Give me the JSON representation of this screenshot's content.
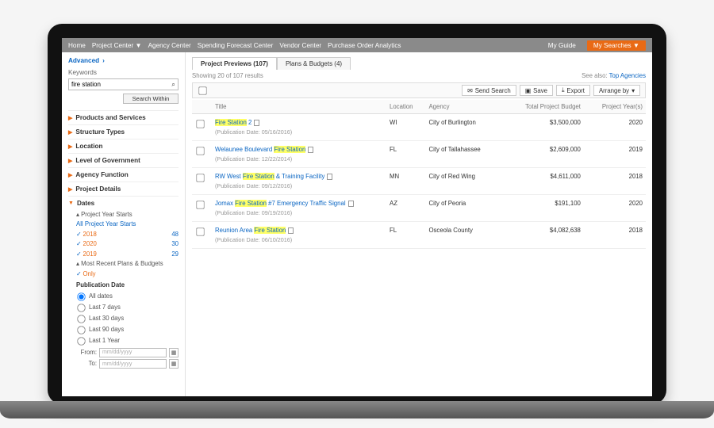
{
  "nav": {
    "items": [
      "Home",
      "Project Center ▼",
      "Agency Center",
      "Spending Forecast Center",
      "Vendor Center",
      "Purchase Order Analytics"
    ],
    "myguide": "My Guide",
    "mysearches": "My Searches ▼"
  },
  "sidebar": {
    "advanced": "Advanced",
    "keywords_label": "Keywords",
    "keywords_value": "fire station",
    "search_within": "Search Within",
    "facets": [
      "Products and Services",
      "Structure Types",
      "Location",
      "Level of Government",
      "Agency Function",
      "Project Details",
      "Dates"
    ],
    "dates": {
      "pys_label": "Project Year Starts",
      "all_pys": "All Project Year Starts",
      "years": [
        {
          "y": "2018",
          "n": "48"
        },
        {
          "y": "2020",
          "n": "30"
        },
        {
          "y": "2019",
          "n": "29"
        }
      ],
      "mrpb": "Most Recent Plans & Budgets",
      "only": "Only",
      "pubdate_label": "Publication Date",
      "radios": [
        "All dates",
        "Last 7 days",
        "Last 30 days",
        "Last 90 days",
        "Last 1 Year"
      ],
      "from": "From:",
      "to": "To:",
      "placeholder": "mm/dd/yyyy"
    }
  },
  "main": {
    "tabs": [
      "Project Previews (107)",
      "Plans & Budgets (4)"
    ],
    "showing": "Showing 20 of 107 results",
    "see_also": "See also:",
    "top_agencies": "Top Agencies",
    "toolbar": {
      "send": "Send Search",
      "save": "Save",
      "export": "Export",
      "arrange": "Arrange by"
    },
    "cols": [
      "Title",
      "Location",
      "Agency",
      "Total Project Budget",
      "Project Year(s)"
    ],
    "rows": [
      {
        "pre": "",
        "mid": "Fire Station",
        "post": " 2",
        "date": "(Publication Date: 05/16/2016)",
        "loc": "WI",
        "agency": "City of Burlington",
        "budget": "$3,500,000",
        "year": "2020"
      },
      {
        "pre": "Welaunee Boulevard ",
        "mid": "Fire Station",
        "post": "",
        "date": "(Publication Date: 12/22/2014)",
        "loc": "FL",
        "agency": "City of Tallahassee",
        "budget": "$2,609,000",
        "year": "2019"
      },
      {
        "pre": "RW West ",
        "mid": "Fire Station",
        "post": " & Training Facility",
        "date": "(Publication Date: 09/12/2016)",
        "loc": "MN",
        "agency": "City of Red Wing",
        "budget": "$4,611,000",
        "year": "2018"
      },
      {
        "pre": "Jomax ",
        "mid": "Fire Station",
        "post": " #7 Emergency Traffic Signal",
        "date": "(Publication Date: 09/19/2016)",
        "loc": "AZ",
        "agency": "City of Peoria",
        "budget": "$191,100",
        "year": "2020"
      },
      {
        "pre": "Reunion Area ",
        "mid": "Fire Station",
        "post": "",
        "date": "(Publication Date: 06/10/2016)",
        "loc": "FL",
        "agency": "Osceola County",
        "budget": "$4,082,638",
        "year": "2018"
      }
    ]
  }
}
